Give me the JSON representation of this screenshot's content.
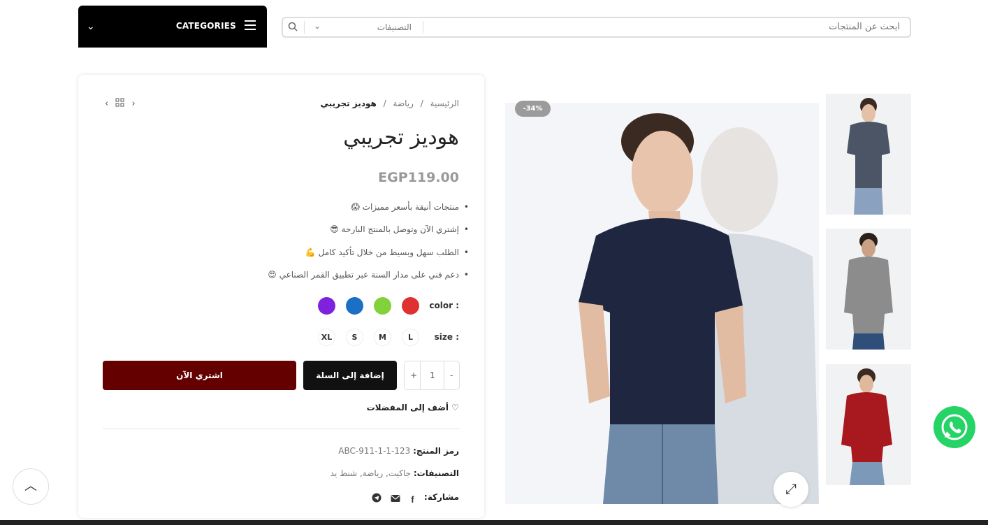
{
  "header": {
    "categories_label": "CATEGORIES",
    "search_placeholder": "ابحث عن المنتجات",
    "search_category_select": "التصنيفات"
  },
  "breadcrumb": {
    "home": "الرئيسية",
    "sep1": "/",
    "category": "رياضة",
    "sep2": "/",
    "current": "هوديز تجريبي"
  },
  "product": {
    "title": "هوديز تجريبي",
    "price": "EGP119.00",
    "discount_badge": "-34%",
    "features": [
      "منتجات أنيقة بأسعر مميزات 😱",
      "إشتري الآن وتوصل بالمنتج البارحة 😎",
      "الطلب سهل وبسيط من خلال تأكيد كامل 💪",
      "دعم فني على مدار السنة عبر تطبيق القمر الصناعي 😍"
    ],
    "color_label": "color :",
    "colors": [
      "#e03131",
      "#82d13b",
      "#1b6fc4",
      "#7e22dd"
    ],
    "size_label": "size :",
    "sizes": [
      "L",
      "M",
      "S",
      "XL"
    ],
    "quantity": "1",
    "qty_minus": "-",
    "qty_plus": "+",
    "add_to_cart": "إضافة إلى السلة",
    "buy_now": "اشتري الآن",
    "wishlist": "أضف إلى المفضلات",
    "sku_label": "رمز المنتج:",
    "sku_value": "ABC-911-1-1-123",
    "categories_label": "التصنيفات:",
    "categories_value": "جاكيت, رياضة, شنط يد",
    "share_label": "مشاركة:"
  },
  "colors": {
    "buy_now_bg": "#650000",
    "cart_bg": "#111111",
    "whatsapp": "#25d366"
  },
  "icons": [
    "menu-icon",
    "chevron-down-icon",
    "search-icon",
    "grid-icon",
    "chevron-left-icon",
    "chevron-right-icon",
    "heart-icon",
    "facebook-icon",
    "mail-icon",
    "telegram-icon",
    "expand-icon",
    "whatsapp-icon",
    "arrow-up-icon"
  ]
}
